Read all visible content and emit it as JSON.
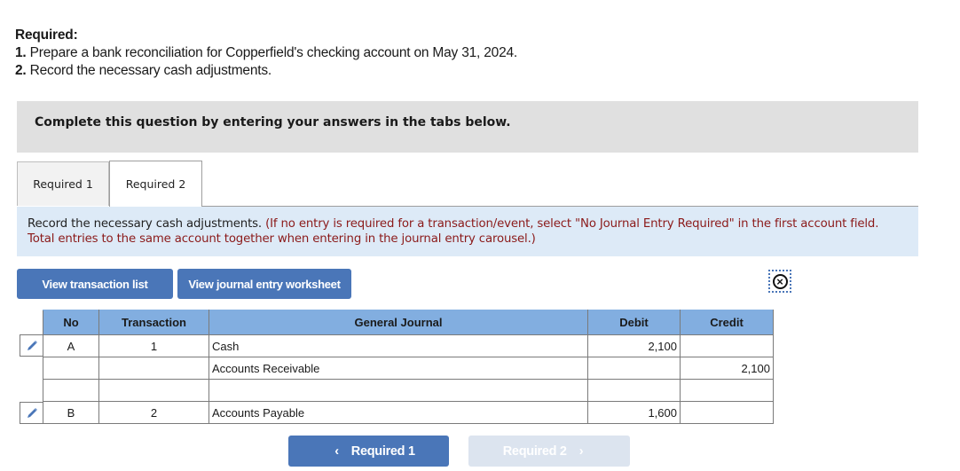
{
  "required": {
    "title": "Required:",
    "items": [
      {
        "num": "1.",
        "text": "Prepare a bank reconciliation for Copperfield's checking account on May 31, 2024."
      },
      {
        "num": "2.",
        "text": "Record the necessary cash adjustments."
      }
    ]
  },
  "banner": "Complete this question by entering your answers in the tabs below.",
  "tabs": [
    {
      "label": "Required 1",
      "active": false
    },
    {
      "label": "Required 2",
      "active": true
    }
  ],
  "instructions": {
    "main": "Record the necessary cash adjustments.",
    "note": "(If no entry is required for a transaction/event, select \"No Journal Entry Required\" in the first account field. Total entries to the same account together when entering in the journal entry carousel.)"
  },
  "buttons": {
    "transaction_list": "View transaction list",
    "journal_worksheet": "View journal entry worksheet",
    "close": "close-circle"
  },
  "journal": {
    "headers": [
      "No",
      "Transaction",
      "General Journal",
      "Debit",
      "Credit"
    ],
    "rows": [
      {
        "no": "A",
        "transaction": "1",
        "account": "Cash",
        "debit": "2,100",
        "credit": "",
        "editable": true
      },
      {
        "no": "",
        "transaction": "",
        "account": "Accounts Receivable",
        "debit": "",
        "credit": "2,100",
        "editable": false
      },
      {
        "no": "",
        "transaction": "",
        "account": "",
        "debit": "",
        "credit": "",
        "editable": false
      },
      {
        "no": "B",
        "transaction": "2",
        "account": "Accounts Payable",
        "debit": "1,600",
        "credit": "",
        "editable": true
      }
    ]
  },
  "nav": {
    "prev_label": "Required 1",
    "next_label": "Required 2",
    "prev_icon": "‹",
    "next_icon": "›"
  },
  "colors": {
    "primary_button": "#4a76b8",
    "table_header": "#82aee0",
    "instruction_bg": "#ddeaf7",
    "note_text": "#8b1a1a",
    "disabled_button": "#dce4ef"
  }
}
